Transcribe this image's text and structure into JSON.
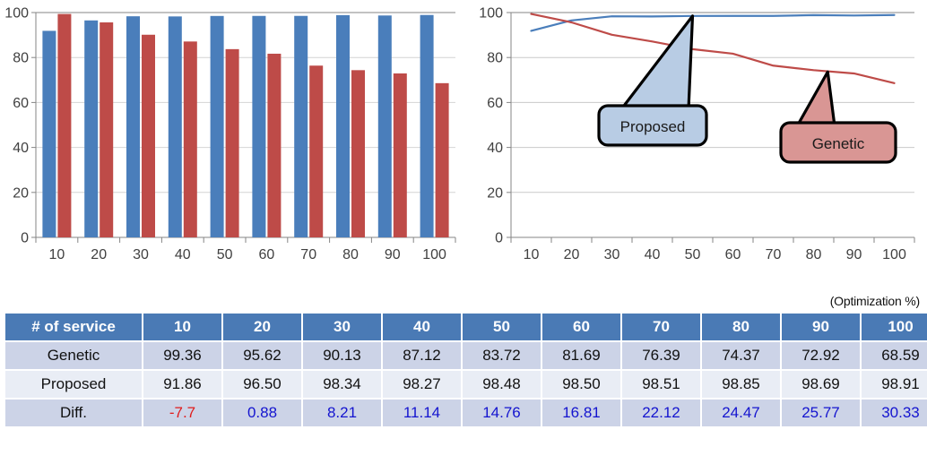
{
  "chart_data": [
    {
      "type": "bar",
      "name": "bar-comparison",
      "title": "",
      "xlabel": "",
      "ylabel": "",
      "categories": [
        "10",
        "20",
        "30",
        "40",
        "50",
        "60",
        "70",
        "80",
        "90",
        "100"
      ],
      "ylim": [
        0,
        100
      ],
      "yticks": [
        0,
        20,
        40,
        60,
        80,
        100
      ],
      "grid": true,
      "legend": "none",
      "series": [
        {
          "name": "Proposed",
          "color": "#4a7ebb",
          "values": [
            91.86,
            96.5,
            98.34,
            98.27,
            98.48,
            98.5,
            98.51,
            98.85,
            98.69,
            98.91
          ]
        },
        {
          "name": "Genetic",
          "color": "#be4b48",
          "values": [
            99.36,
            95.62,
            90.13,
            87.12,
            83.72,
            81.69,
            76.39,
            74.37,
            72.92,
            68.59
          ]
        }
      ]
    },
    {
      "type": "line",
      "name": "line-comparison",
      "title": "",
      "xlabel": "",
      "ylabel": "",
      "x": [
        10,
        20,
        30,
        40,
        50,
        60,
        70,
        80,
        90,
        100
      ],
      "xticklabels": [
        "10",
        "20",
        "30",
        "40",
        "50",
        "60",
        "70",
        "80",
        "90",
        "100"
      ],
      "ylim": [
        0,
        100
      ],
      "yticks": [
        0,
        20,
        40,
        60,
        80,
        100
      ],
      "grid": true,
      "legend": "callouts",
      "series": [
        {
          "name": "Proposed",
          "color": "#4a7ebb",
          "values": [
            91.86,
            96.5,
            98.34,
            98.27,
            98.48,
            98.5,
            98.51,
            98.85,
            98.69,
            98.91
          ]
        },
        {
          "name": "Genetic",
          "color": "#be4b48",
          "values": [
            99.36,
            95.62,
            90.13,
            87.12,
            83.72,
            81.69,
            76.39,
            74.37,
            72.92,
            68.59
          ]
        }
      ],
      "annotations": [
        {
          "label": "Proposed",
          "fill": "#b8cce4",
          "stroke": "#000000",
          "points_at": 50
        },
        {
          "label": "Genetic",
          "fill": "#d99694",
          "stroke": "#000000",
          "points_at": 83
        }
      ]
    }
  ],
  "table": {
    "caption": "(Optimization %)",
    "header_bg": "#4a7ab5",
    "row_odd_bg": "#ccd3e7",
    "row_even_bg": "#e9edf5",
    "diff_positive_color": "#1414cf",
    "diff_negative_color": "#e01b1b",
    "columns": [
      "# of service",
      "10",
      "20",
      "30",
      "40",
      "50",
      "60",
      "70",
      "80",
      "90",
      "100"
    ],
    "rows": [
      {
        "label": "Genetic",
        "values": [
          "99.36",
          "95.62",
          "90.13",
          "87.12",
          "83.72",
          "81.69",
          "76.39",
          "74.37",
          "72.92",
          "68.59"
        ]
      },
      {
        "label": "Proposed",
        "values": [
          "91.86",
          "96.50",
          "98.34",
          "98.27",
          "98.48",
          "98.50",
          "98.51",
          "98.85",
          "98.69",
          "98.91"
        ]
      },
      {
        "label": "Diff.",
        "values": [
          "-7.7",
          "0.88",
          "8.21",
          "11.14",
          "14.76",
          "16.81",
          "22.12",
          "24.47",
          "25.77",
          "30.33"
        ]
      }
    ]
  }
}
